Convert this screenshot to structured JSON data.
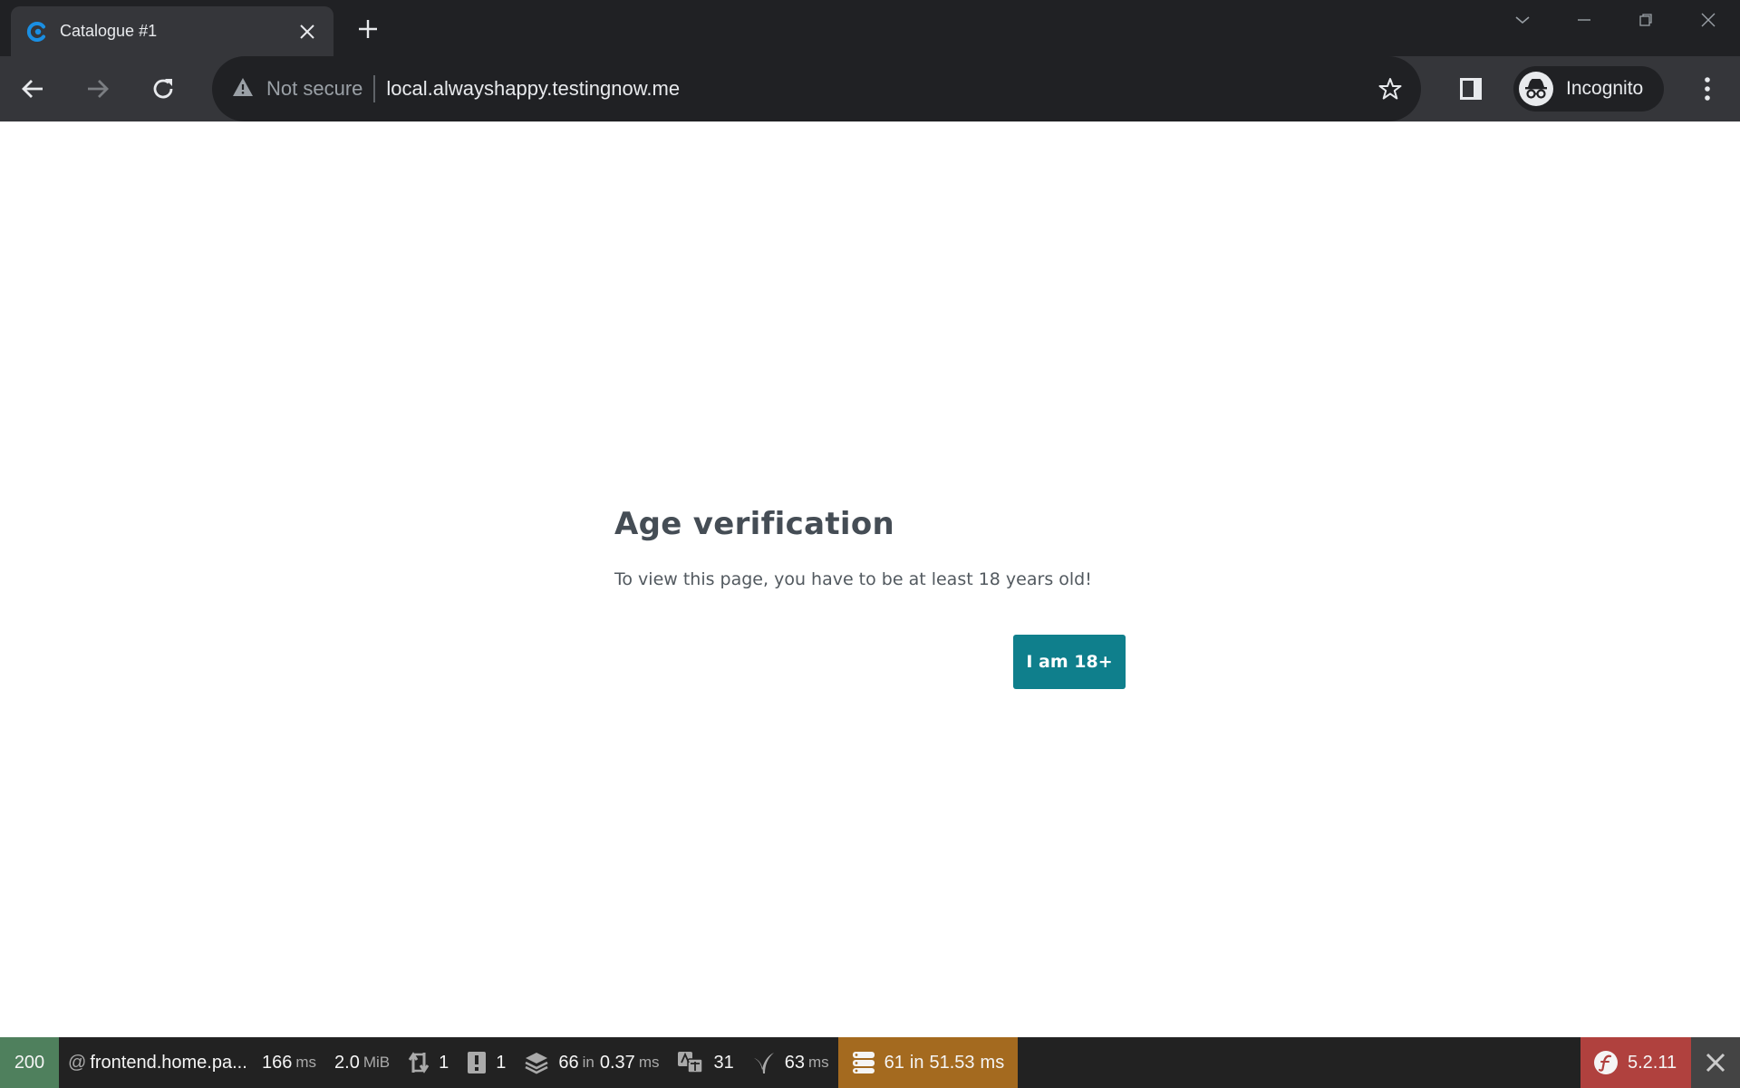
{
  "browser": {
    "tab": {
      "title": "Catalogue #1",
      "icon": "catalogue-favicon"
    },
    "omnibox": {
      "security_label": "Not secure",
      "url": "local.alwayshappy.testingnow.me"
    },
    "profile": {
      "label": "Incognito"
    }
  },
  "page": {
    "heading": "Age verification",
    "message": "To view this page, you have to be at least 18 years old!",
    "confirm_button": "I am 18+",
    "accent_color": "#0f7f8c"
  },
  "debug_toolbar": {
    "status_code": "200",
    "route": "frontend.home.pa...",
    "time": {
      "value": "166",
      "unit": "ms"
    },
    "memory": {
      "value": "2.0",
      "unit": "MiB"
    },
    "requests": "1",
    "logs": "1",
    "cache": {
      "value": "66",
      "in": "in",
      "time": "0.37",
      "unit": "ms"
    },
    "translations": "31",
    "twig": {
      "value": "63",
      "unit": "ms"
    },
    "database": {
      "value": "61",
      "in": "in",
      "time": "51.53",
      "unit": "ms"
    },
    "symfony_version": "5.2.11"
  }
}
